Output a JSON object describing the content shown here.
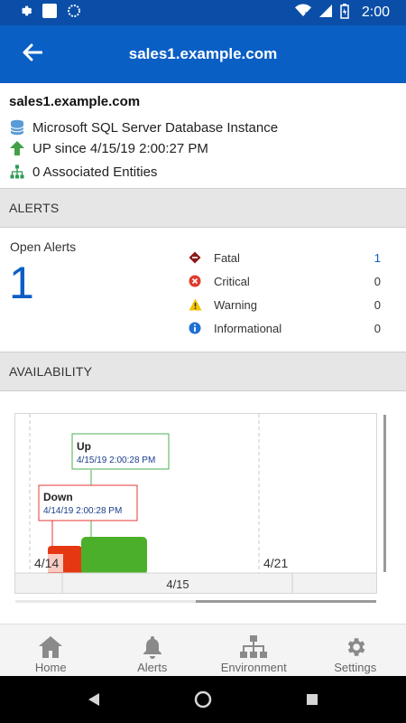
{
  "status_bar": {
    "time": "2:00",
    "icons": [
      "gear-icon",
      "square-icon",
      "circle-icon",
      "wifi-icon",
      "signal-icon",
      "battery-icon"
    ]
  },
  "app_bar": {
    "title": "sales1.example.com",
    "back_icon": "arrow-left-icon"
  },
  "info": {
    "host": "sales1.example.com",
    "type": "Microsoft SQL Server Database Instance",
    "status": "UP since 4/15/19 2:00:27 PM",
    "entities": "0 Associated Entities"
  },
  "alerts": {
    "header": "ALERTS",
    "open_label": "Open Alerts",
    "open_count": "1",
    "rows": [
      {
        "label": "Fatal",
        "count": "1",
        "icon": "fatal-icon",
        "color": "#8b1a1a"
      },
      {
        "label": "Critical",
        "count": "0",
        "icon": "critical-icon",
        "color": "#e03a2b"
      },
      {
        "label": "Warning",
        "count": "0",
        "icon": "warning-icon",
        "color": "#f3c300"
      },
      {
        "label": "Informational",
        "count": "0",
        "icon": "info-icon",
        "color": "#1f6fd1"
      }
    ]
  },
  "availability": {
    "header": "AVAILABILITY",
    "callouts": [
      {
        "title": "Up",
        "time": "4/15/19 2:00:28 PM",
        "color": "#4caf50"
      },
      {
        "title": "Down",
        "time": "4/14/19 2:00:28 PM",
        "color": "#e53935"
      }
    ],
    "axis_dates": [
      "4/14",
      "4/21"
    ],
    "bottom_label": "4/15",
    "colors": {
      "up": "#4caf29",
      "down": "#e53712"
    }
  },
  "bottom_nav": [
    {
      "label": "Home",
      "icon": "home-icon"
    },
    {
      "label": "Alerts",
      "icon": "bell-icon"
    },
    {
      "label": "Environment",
      "icon": "network-icon"
    },
    {
      "label": "Settings",
      "icon": "gear-icon"
    }
  ],
  "system_nav": [
    "back-triangle-icon",
    "home-circle-icon",
    "recents-square-icon"
  ]
}
